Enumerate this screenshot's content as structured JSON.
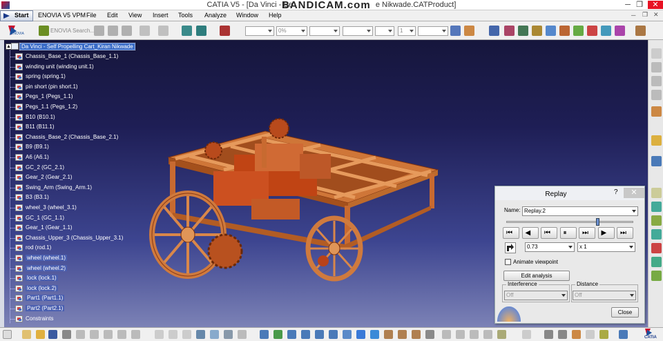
{
  "window": {
    "title": "CATIA V5 - [Da Vinci - Se",
    "title_tail": "e Nikwade.CATProduct]",
    "watermark": "BANDICAM.com",
    "min": "─",
    "max": "❐",
    "close": "✕"
  },
  "menu": {
    "start": "Start",
    "items": [
      "ENOVIA V5 VPM",
      "File",
      "Edit",
      "View",
      "Insert",
      "Tools",
      "Analyze",
      "Window",
      "Help"
    ]
  },
  "toolbar": {
    "enovia_label": "ENOVIA",
    "enovia_search": "ENOVIA Search...",
    "zero_percent": "0%",
    "line_weight": "1"
  },
  "tree": {
    "root": "Da Vinci - Self Propelling Cart_Kiran Nikwade",
    "items": [
      {
        "label": "Chassis_Base_1 (Chassis_Base_1.1)",
        "hl": false
      },
      {
        "label": "winding unit (winding unit.1)",
        "hl": false
      },
      {
        "label": "spring (spring.1)",
        "hl": false
      },
      {
        "label": "pin short (pin short.1)",
        "hl": false
      },
      {
        "label": "Pegs_1 (Pegs_1.1)",
        "hl": false
      },
      {
        "label": "Pegs_1.1 (Pegs_1.2)",
        "hl": false
      },
      {
        "label": "B10 (B10.1)",
        "hl": false
      },
      {
        "label": "B11 (B11.1)",
        "hl": false
      },
      {
        "label": "Chassis_Base_2 (Chassis_Base_2.1)",
        "hl": false
      },
      {
        "label": "B9 (B9.1)",
        "hl": false
      },
      {
        "label": "A6 (A6.1)",
        "hl": false
      },
      {
        "label": "GC_2 (GC_2.1)",
        "hl": false
      },
      {
        "label": "Gear_2 (Gear_2.1)",
        "hl": false
      },
      {
        "label": "Swing_Arm (Swing_Arm.1)",
        "hl": false
      },
      {
        "label": "B3 (B3.1)",
        "hl": false
      },
      {
        "label": "wheel_3 (wheel_3.1)",
        "hl": false
      },
      {
        "label": "GC_1 (GC_1.1)",
        "hl": false
      },
      {
        "label": "Gear_1 (Gear_1.1)",
        "hl": false
      },
      {
        "label": "Chassis_Upper_3 (Chassis_Upper_3.1)",
        "hl": false
      },
      {
        "label": "rod (rod.1)",
        "hl": false
      },
      {
        "label": "wheel (wheel.1)",
        "hl": true
      },
      {
        "label": "wheel (wheel.2)",
        "hl": true
      },
      {
        "label": "lock (lock.1)",
        "hl": true
      },
      {
        "label": "lock (lock.2)",
        "hl": true
      },
      {
        "label": "Part1 (Part1.1)",
        "hl": true
      },
      {
        "label": "Part2 (Part2.1)",
        "hl": true
      },
      {
        "label": "Constraints",
        "hl": false
      }
    ]
  },
  "replay": {
    "title": "Replay",
    "help": "?",
    "close": "✕",
    "name_label": "Name:",
    "name_value": "Replay.2",
    "step_value": "0.73",
    "speed_value": "x 1",
    "slider_position": 0.72,
    "animate_viewpoint": "Animate viewpoint",
    "edit_analysis": "Edit analysis",
    "interference_label": "Interference",
    "interference_value": "Off",
    "distance_label": "Distance",
    "distance_value": "Off",
    "close_button": "Close"
  },
  "player_buttons": [
    {
      "name": "jump-to-start-icon",
      "glyph": "⏮"
    },
    {
      "name": "play-backward-icon",
      "glyph": "◀"
    },
    {
      "name": "step-backward-icon",
      "glyph": "⏮"
    },
    {
      "name": "pause-icon",
      "glyph": "⏸"
    },
    {
      "name": "step-forward-icon",
      "glyph": "⏭"
    },
    {
      "name": "play-forward-icon",
      "glyph": "▶"
    },
    {
      "name": "jump-to-end-icon",
      "glyph": "⏭"
    }
  ],
  "colors": {
    "model": "#d47a3c",
    "model_dark": "#8c3a12",
    "background_top": "#16163c",
    "background_bottom": "#7c82b6",
    "tree_highlight": "#4a5fb0",
    "root_highlight": "#3a6cc8"
  },
  "catia_logo": "CATIA"
}
